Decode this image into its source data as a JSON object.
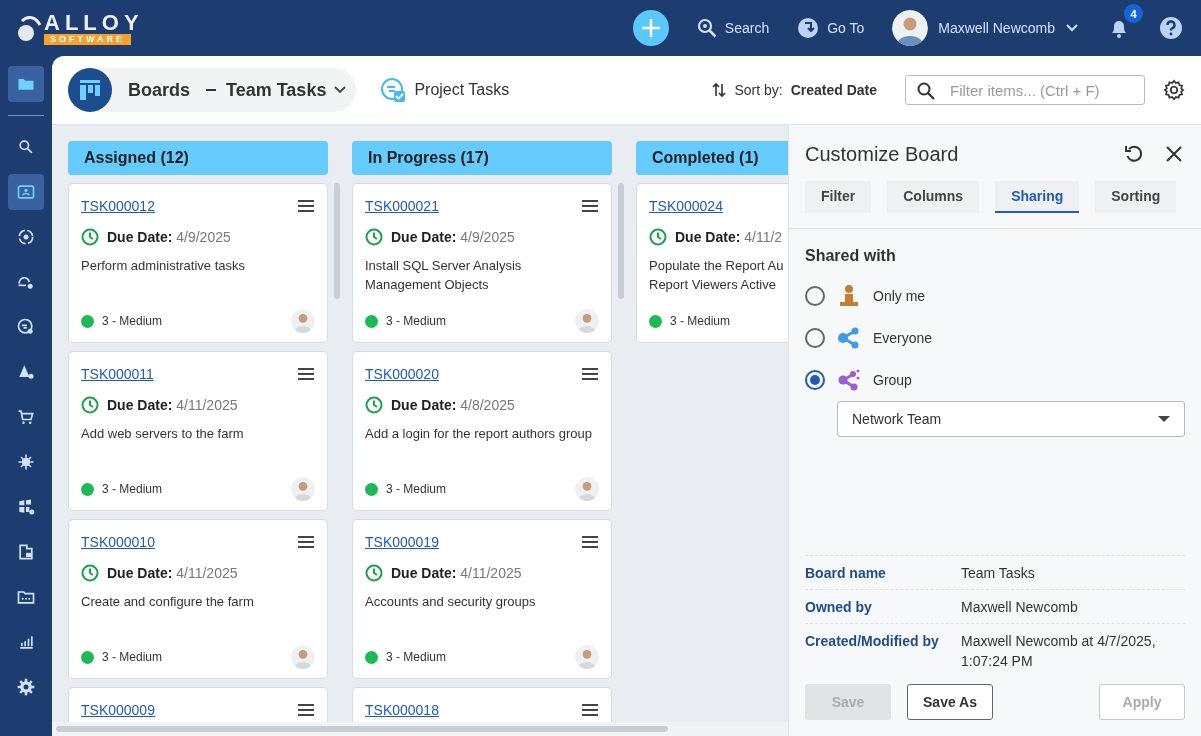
{
  "header": {
    "logo_word": "ALLOY",
    "logo_sub": "SOFTWARE",
    "search_label": "Search",
    "goto_label": "Go To",
    "user_name": "Maxwell Newcomb",
    "notification_count": "4"
  },
  "sidebar": {
    "items": [
      {
        "selected": true
      },
      {
        "selected": false
      },
      {
        "selected": true
      },
      {
        "selected": false
      },
      {
        "selected": false
      },
      {
        "selected": false
      },
      {
        "selected": false
      },
      {
        "selected": false
      },
      {
        "selected": false
      },
      {
        "selected": false
      },
      {
        "selected": false
      },
      {
        "selected": false
      },
      {
        "selected": false
      },
      {
        "selected": false
      }
    ]
  },
  "toolbar": {
    "boards_label": "Boards",
    "board_name": "Team Tasks",
    "project_tasks_label": "Project Tasks",
    "sort_label": "Sort by:",
    "sort_value": "Created Date",
    "filter_placeholder": "Filter items... (Ctrl + F)"
  },
  "columns": [
    {
      "title": "Assigned (12)",
      "cards": [
        {
          "id": "TSK000012",
          "due_label": "Due Date:",
          "due": "4/9/2025",
          "description": "Perform administrative tasks",
          "priority": "3 - Medium",
          "avatar": true
        },
        {
          "id": "TSK000011",
          "due_label": "Due Date:",
          "due": "4/11/2025",
          "description": "Add web servers to the farm",
          "priority": "3 - Medium",
          "avatar": true
        },
        {
          "id": "TSK000010",
          "due_label": "Due Date:",
          "due": "4/11/2025",
          "description": "Create and configure the farm",
          "priority": "3 - Medium",
          "avatar": true
        },
        {
          "id": "TSK000009"
        }
      ]
    },
    {
      "title": "In Progress (17)",
      "cards": [
        {
          "id": "TSK000021",
          "due_label": "Due Date:",
          "due": "4/9/2025",
          "description": "Install SQL Server Analysis Management Objects",
          "priority": "3 - Medium",
          "avatar": true
        },
        {
          "id": "TSK000020",
          "due_label": "Due Date:",
          "due": "4/8/2025",
          "description": "Add a login for the report authors group",
          "priority": "3 - Medium",
          "avatar": true
        },
        {
          "id": "TSK000019",
          "due_label": "Due Date:",
          "due": "4/11/2025",
          "description": "Accounts and security groups",
          "priority": "3 - Medium",
          "avatar": true
        },
        {
          "id": "TSK000018"
        }
      ]
    },
    {
      "title": "Completed (1)",
      "cards": [
        {
          "id": "TSK000024",
          "due_label": "Due Date:",
          "due": "4/11/2",
          "description_lines": [
            "Populate the Report Au",
            "Report Viewers Active"
          ],
          "priority": "3 - Medium"
        }
      ]
    }
  ],
  "panel": {
    "title": "Customize Board",
    "tabs": [
      {
        "label": "Filter",
        "selected": false
      },
      {
        "label": "Columns",
        "selected": false
      },
      {
        "label": "Sharing",
        "selected": true
      },
      {
        "label": "Sorting",
        "selected": false
      }
    ],
    "section_title": "Shared with",
    "options": [
      {
        "kind": "person",
        "label": "Only me",
        "selected": false
      },
      {
        "kind": "everyone",
        "label": "Everyone",
        "selected": false
      },
      {
        "kind": "group",
        "label": "Group",
        "selected": true
      }
    ],
    "group_select": {
      "value": "Network Team"
    },
    "info": [
      {
        "label": "Board name",
        "value": "Team Tasks"
      },
      {
        "label": "Owned by",
        "value": "Maxwell Newcomb"
      },
      {
        "label": "Created/Modified by",
        "value": "Maxwell Newcomb at 4/7/2025, 1:07:24 PM"
      }
    ],
    "buttons": [
      {
        "label": "Save",
        "kind": "filled",
        "disabled": true
      },
      {
        "label": "Save As",
        "kind": "outline",
        "disabled": false
      },
      {
        "label": "Apply",
        "kind": "outline",
        "disabled": true
      }
    ]
  }
}
